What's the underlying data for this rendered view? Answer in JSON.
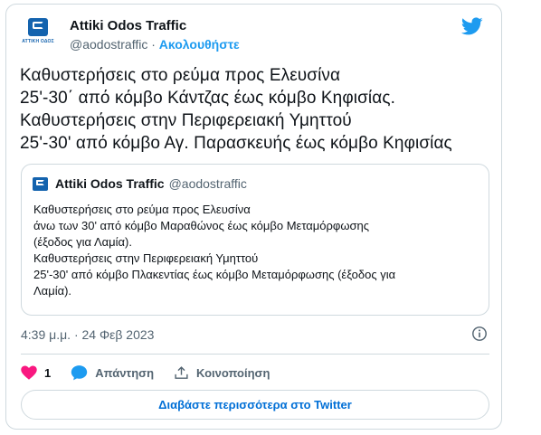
{
  "author": {
    "name": "Attiki Odos Traffic",
    "handle": "@aodostraffic",
    "separator": " · ",
    "follow_label": "Ακολουθήστε",
    "avatar_brand_text": "ΑΤΤΙΚΗ ΟΔΟΣ"
  },
  "tweet": {
    "text": "Καθυστερήσεις στο ρεύμα προς Ελευσίνα\n25'-30΄ από κόμβο Κάντζας έως κόμβο Κηφισίας.\nΚαθυστερήσεις στην Περιφερειακή Υμηττού\n25'-30' από κόμβο Αγ. Παρασκευής έως κόμβο Κηφισίας"
  },
  "quote": {
    "name": "Attiki Odos Traffic",
    "handle": "@aodostraffic",
    "text": "Καθυστερήσεις στο ρεύμα προς Ελευσίνα\nάνω των 30' από κόμβο Μαραθώνος έως κόμβο Μεταμόρφωσης\n(έξοδος για Λαμία).\nΚαθυστερήσεις στην Περιφερειακή Υμηττού\n25'-30' από κόμβο Πλακεντίας έως κόμβο Μεταμόρφωσης (έξοδος για\nΛαμία)."
  },
  "meta": {
    "timestamp": "4:39 μ.μ. · 24 Φεβ 2023"
  },
  "actions": {
    "like_count": "1",
    "reply_label": "Απάντηση",
    "share_label": "Κοινοποίηση"
  },
  "footer": {
    "read_more_label": "Διαβάστε περισσότερα στο Twitter"
  },
  "colors": {
    "accent": "#1d9bf0",
    "brand": "#1463ae",
    "like": "#f91880",
    "text": "#0f1419",
    "muted": "#536471",
    "border": "#cfd9de"
  },
  "icons": [
    "twitter-bird-icon",
    "info-icon",
    "heart-icon",
    "reply-bubble-icon",
    "share-icon"
  ]
}
